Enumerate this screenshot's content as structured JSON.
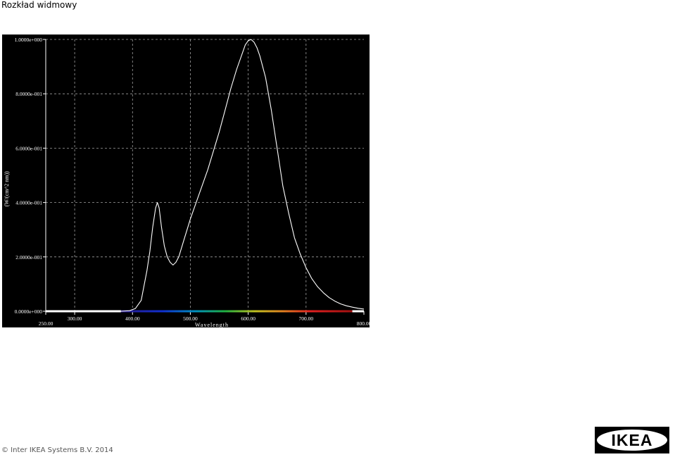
{
  "page": {
    "title": "Rozkład widmowy",
    "copyright": "© Inter IKEA Systems B.V. 2014",
    "logo_text": "IKEA"
  },
  "colors": {
    "plot_bg": "#000000",
    "curve": "#ffffff",
    "grid": "#a0a0a0",
    "logo": "#000000"
  },
  "chart_data": {
    "type": "line",
    "title": "",
    "xlabel": "Wavelength",
    "ylabel": "(W/(cm^2 nm))",
    "xlim": [
      250,
      800
    ],
    "ylim": [
      0,
      1
    ],
    "grid": true,
    "x_ticks_upper": [
      {
        "value": 300,
        "label": "300.00"
      },
      {
        "value": 400,
        "label": "400.00"
      },
      {
        "value": 500,
        "label": "500.00"
      },
      {
        "value": 600,
        "label": "600.00"
      },
      {
        "value": 700,
        "label": "700.00"
      }
    ],
    "x_ticks_lower": [
      {
        "value": 250,
        "label": "250.00"
      },
      {
        "value": 800,
        "label": "800.00"
      }
    ],
    "y_ticks": [
      {
        "value": 0,
        "label": "0.0000e+000"
      },
      {
        "value": 0.2,
        "label": "2.0000e-001"
      },
      {
        "value": 0.4,
        "label": "4.0000e-001"
      },
      {
        "value": 0.6,
        "label": "6.0000e-001"
      },
      {
        "value": 0.8,
        "label": "8.0000e-001"
      },
      {
        "value": 1.0,
        "label": "1.0000e+000"
      }
    ],
    "spectrum_band": [
      380,
      780
    ],
    "series": [
      {
        "x": [
          380,
          395,
          405,
          415,
          425,
          430,
          435,
          440,
          443,
          446,
          450,
          455,
          460,
          465,
          470,
          475,
          480,
          490,
          500,
          510,
          520,
          530,
          540,
          550,
          560,
          570,
          580,
          590,
          595,
          600,
          605,
          610,
          615,
          620,
          630,
          640,
          650,
          660,
          670,
          680,
          690,
          700,
          710,
          720,
          730,
          740,
          750,
          760,
          770,
          780,
          790,
          800
        ],
        "y": [
          0,
          0.002,
          0.01,
          0.04,
          0.15,
          0.22,
          0.31,
          0.38,
          0.4,
          0.38,
          0.31,
          0.24,
          0.2,
          0.18,
          0.17,
          0.18,
          0.2,
          0.27,
          0.34,
          0.4,
          0.46,
          0.52,
          0.59,
          0.66,
          0.74,
          0.82,
          0.89,
          0.95,
          0.98,
          0.995,
          1.0,
          0.99,
          0.97,
          0.94,
          0.86,
          0.74,
          0.6,
          0.46,
          0.36,
          0.27,
          0.21,
          0.16,
          0.12,
          0.09,
          0.068,
          0.05,
          0.037,
          0.027,
          0.02,
          0.015,
          0.011,
          0.008
        ]
      }
    ]
  }
}
